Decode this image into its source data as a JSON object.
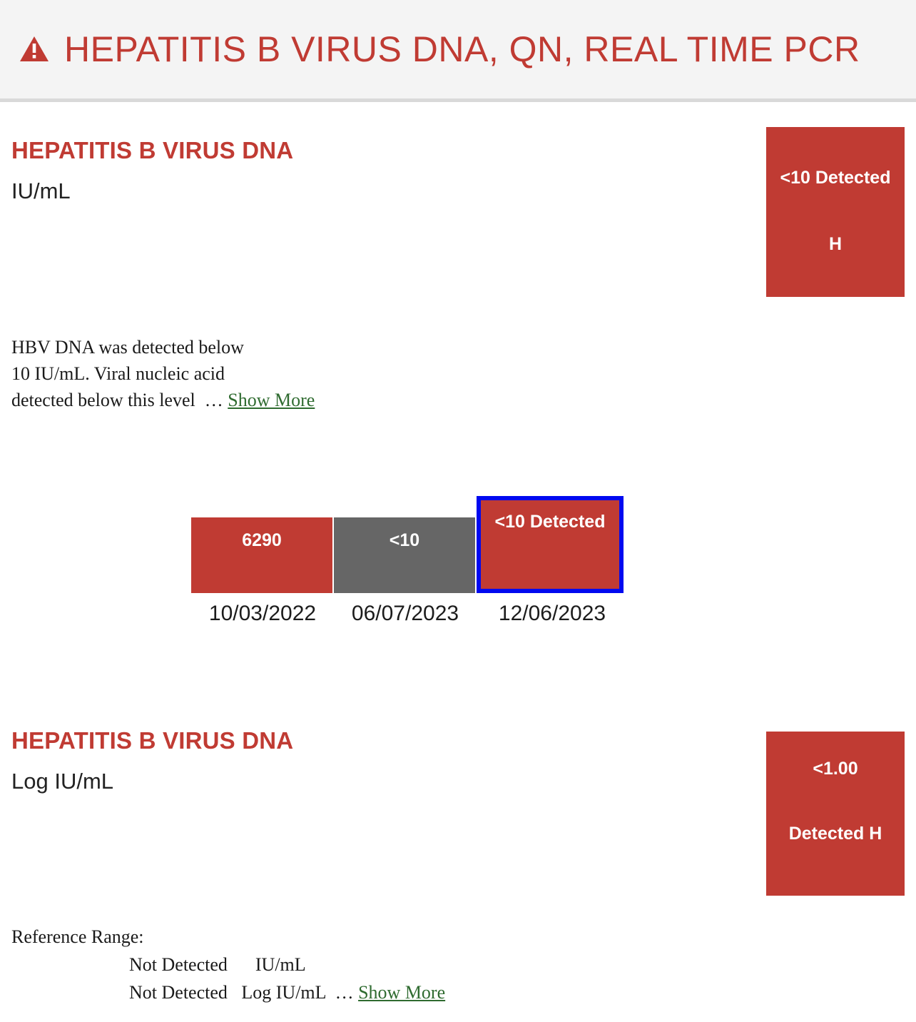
{
  "header": {
    "icon": "warning-triangle-icon",
    "title": "HEPATITIS B VIRUS DNA, QN, REAL TIME PCR",
    "accent_color": "#c03b33",
    "background_color": "#f4f4f4"
  },
  "results": [
    {
      "name": "HEPATITIS B VIRUS DNA",
      "units": "IU/mL",
      "badge": {
        "line_a": "<10 Detected",
        "line_b": "H",
        "color": "#c03b33"
      },
      "comment": {
        "line_1": "HBV DNA was detected below",
        "line_2": "10 IU/mL. Viral nucleic acid",
        "line_3": "detected below this level",
        "ellipsis": "…",
        "show_more": "Show More"
      }
    },
    {
      "name": "HEPATITIS B VIRUS DNA",
      "units": "Log IU/mL",
      "badge": {
        "line_a": "<1.00",
        "line_b": "Detected H",
        "color": "#c03b33"
      },
      "reference_range": {
        "label": "Reference Range:",
        "row_1": "Not Detected      IU/mL",
        "row_2": "Not Detected   Log IU/mL",
        "ellipsis": "…",
        "show_more": "Show More"
      }
    }
  ],
  "chart_data": {
    "type": "bar",
    "title": "",
    "xlabel": "",
    "ylabel": "",
    "categories": [
      "10/03/2022",
      "06/07/2023",
      "12/06/2023"
    ],
    "values": [
      "6290",
      "<10",
      "<10 Detected"
    ],
    "bar_colors": [
      "#c03b33",
      "#666666",
      "#c03b33"
    ],
    "selected_index": 2,
    "selection_border_color": "#0009f0",
    "grid": false,
    "legend": "none"
  }
}
